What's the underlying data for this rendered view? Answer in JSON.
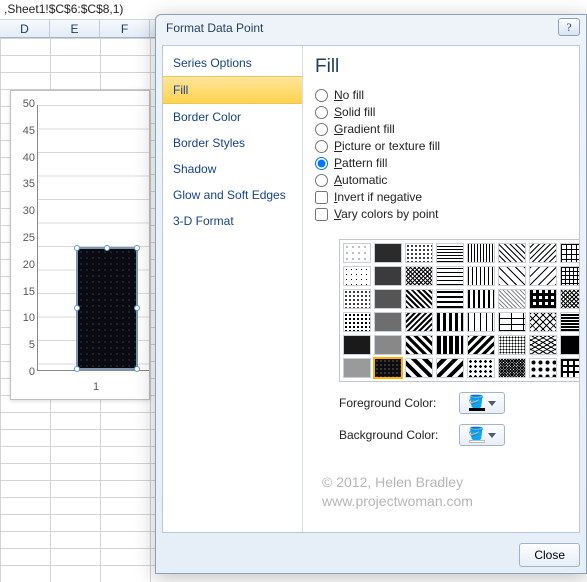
{
  "formula_cell_ref": ",Sheet1!$C$6:$C$8,1)",
  "columns": [
    "D",
    "E",
    "F"
  ],
  "chart_data": {
    "type": "bar",
    "categories": [
      "1"
    ],
    "values": [
      23
    ],
    "xlabel": "",
    "ylabel": "",
    "ylim": [
      0,
      50
    ],
    "yticks": [
      0,
      5,
      10,
      15,
      20,
      25,
      30,
      35,
      40,
      45,
      50
    ]
  },
  "dialog": {
    "title": "Format Data Point",
    "help_glyph": "?",
    "sidebar": [
      "Series Options",
      "Fill",
      "Border Color",
      "Border Styles",
      "Shadow",
      "Glow and Soft Edges",
      "3-D Format"
    ],
    "sidebar_selected_index": 1,
    "panel": {
      "heading": "Fill",
      "radios": [
        "No fill",
        "Solid fill",
        "Gradient fill",
        "Picture or texture fill",
        "Pattern fill",
        "Automatic"
      ],
      "radio_selected_index": 4,
      "checkboxes": [
        "Invert if negative",
        "Vary colors by point"
      ],
      "pattern_count": 48,
      "pattern_selected_index": 41,
      "fg_label": "Foreground Color:",
      "bg_label": "Background Color:",
      "fg_swatch": "#000000",
      "bg_swatch": "#ffffff"
    },
    "close_button": "Close"
  },
  "watermark_line1": "© 2012, Helen Bradley",
  "watermark_line2": "www.projectwoman.com"
}
